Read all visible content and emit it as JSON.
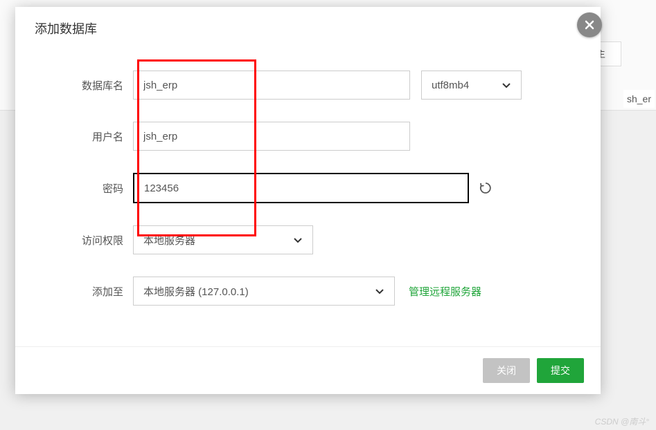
{
  "background": {
    "tab_text": "主",
    "row_text": "sh_er"
  },
  "modal": {
    "title": "添加数据库",
    "labels": {
      "db_name": "数据库名",
      "username": "用户名",
      "password": "密码",
      "access": "访问权限",
      "add_to": "添加至"
    },
    "values": {
      "db_name": "jsh_erp",
      "username": "jsh_erp",
      "password": "123456",
      "charset": "utf8mb4",
      "access": "本地服务器",
      "add_to": "本地服务器 (127.0.0.1)"
    },
    "manage_link": "管理远程服务器",
    "buttons": {
      "close": "关闭",
      "submit": "提交"
    }
  },
  "watermark": "CSDN @南斗°"
}
